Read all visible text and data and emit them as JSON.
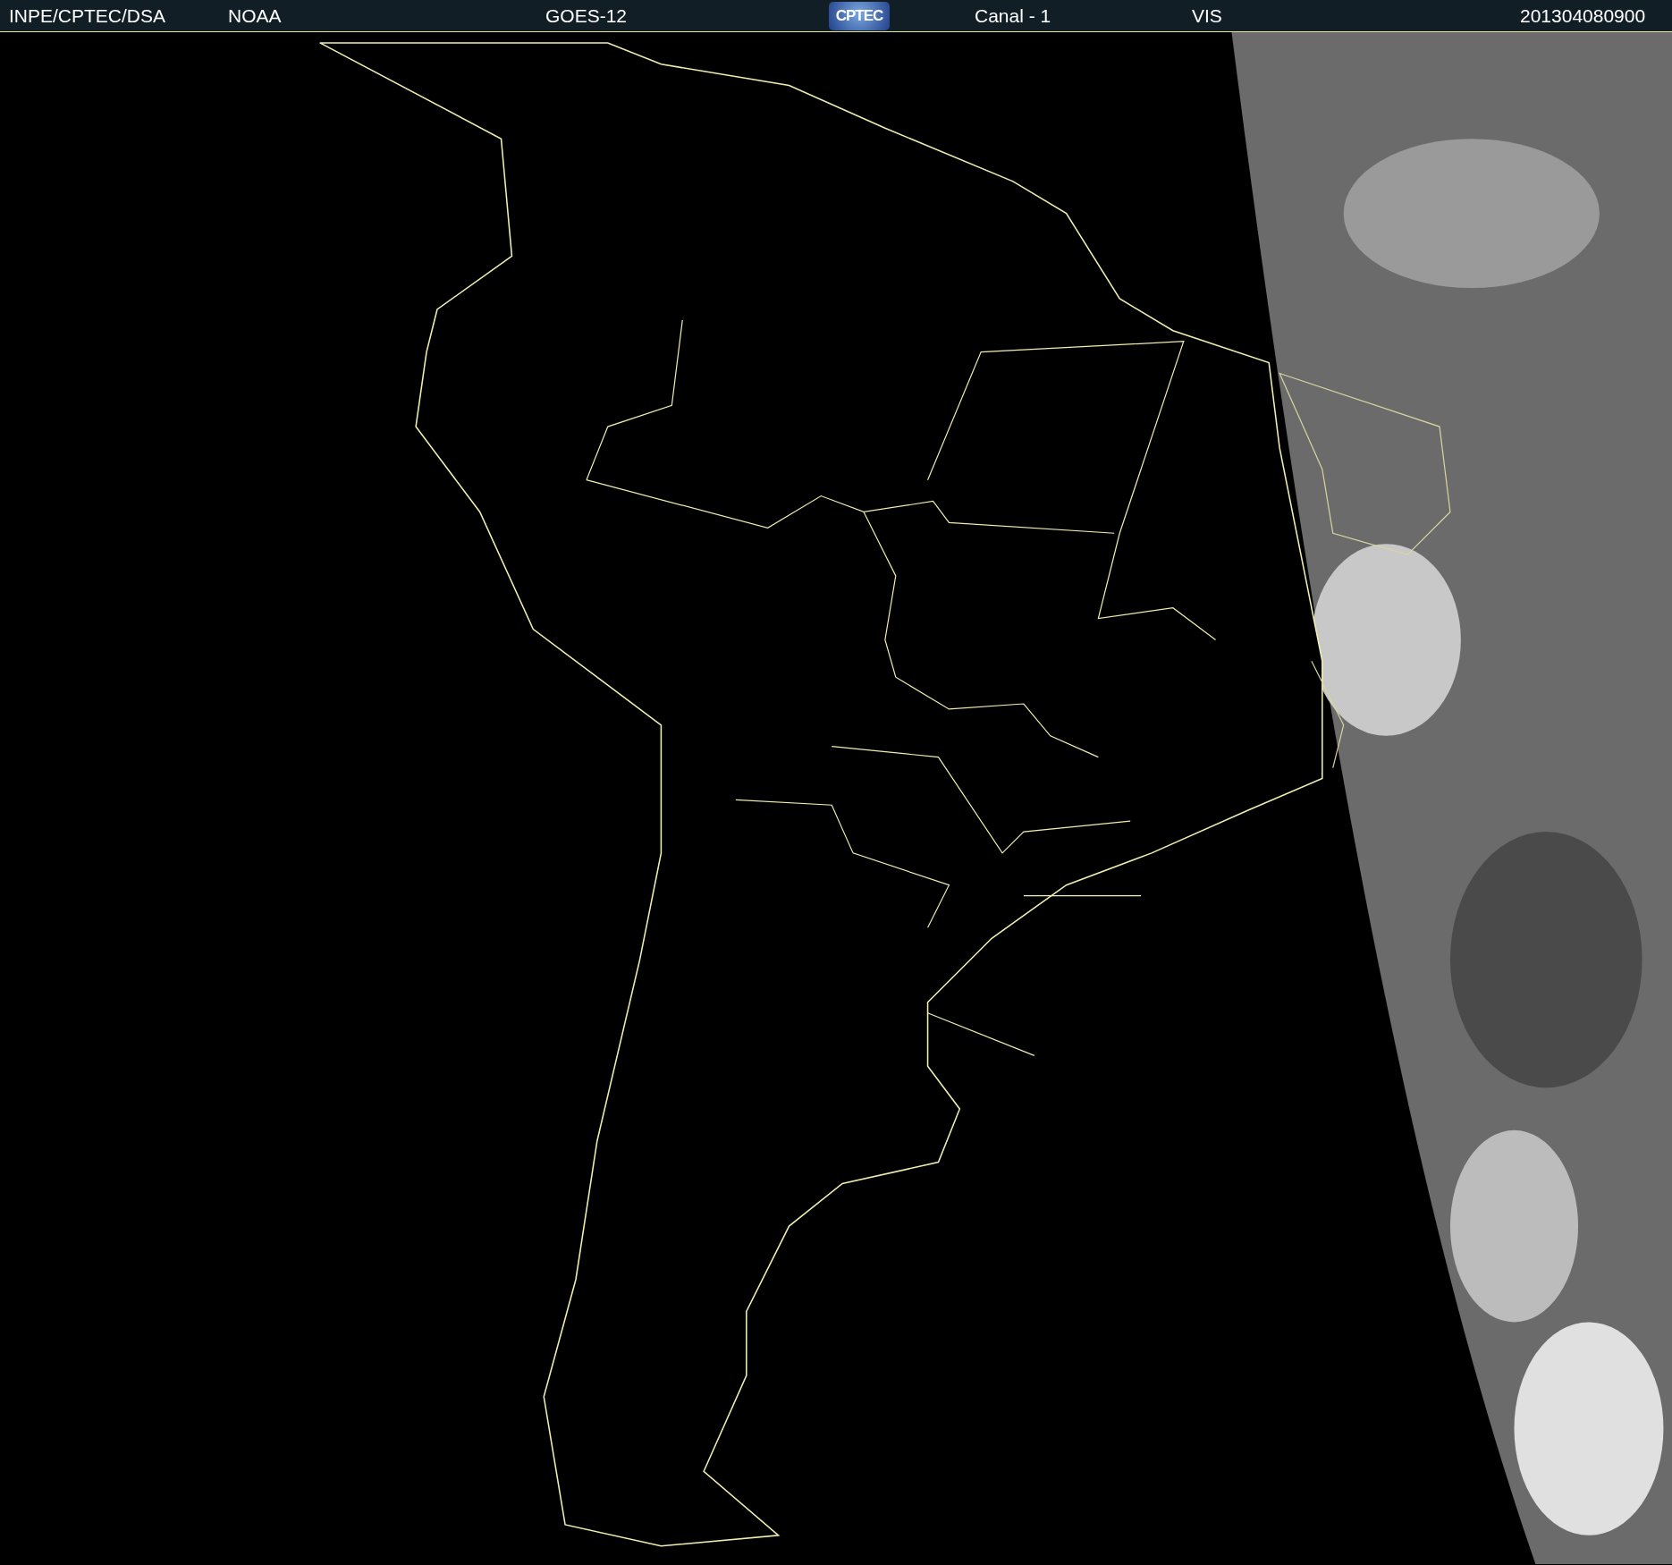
{
  "header": {
    "items": [
      {
        "kind": "text",
        "text": "INPE/CPTEC/DSA"
      },
      {
        "kind": "text",
        "text": "NOAA"
      },
      {
        "kind": "text",
        "text": "GOES-12"
      },
      {
        "kind": "logo",
        "text": "CPTEC"
      },
      {
        "kind": "text",
        "text": "Canal - 1"
      },
      {
        "kind": "text",
        "text": "VIS"
      },
      {
        "kind": "text",
        "text": "201304080900"
      }
    ]
  }
}
